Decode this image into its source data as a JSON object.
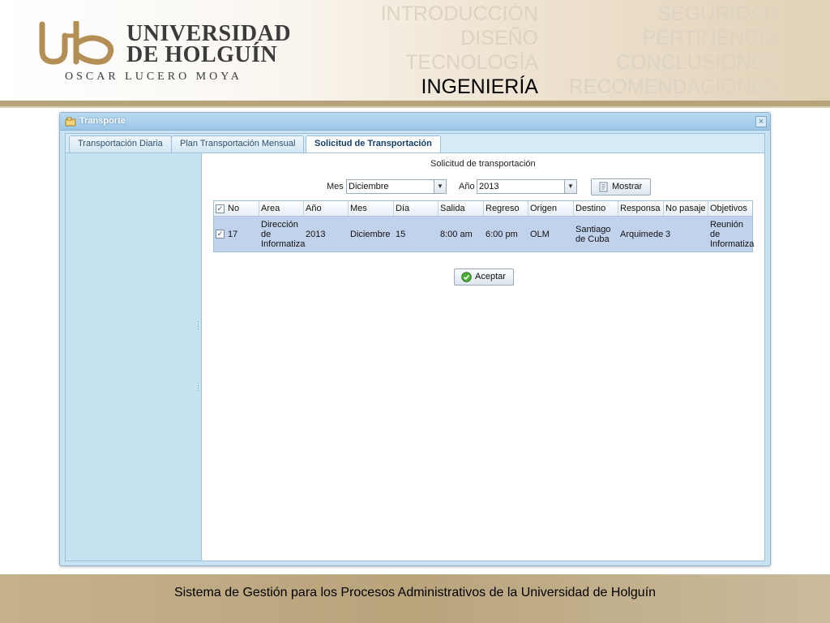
{
  "logo": {
    "line1": "UNIVERSIDAD",
    "line2": "DE HOLGUÍN",
    "subtitle": "OSCAR LUCERO MOYA"
  },
  "nav": {
    "left": [
      "INTRODUCCIÓN",
      "DISEÑO",
      "TECNOLOGÍA",
      "INGENIERÍA"
    ],
    "right": [
      "SEGURIDAD",
      "PERTINENCIA",
      "CONCLUSIONES",
      "RECOMENDACIONES"
    ],
    "active": "INGENIERÍA"
  },
  "window": {
    "title": "Transporte",
    "tabs": [
      "Transportación Diaria",
      "Plan Transportación Mensual",
      "Solicitud de Transportación"
    ],
    "active_tab": "Solicitud de Transportación"
  },
  "form": {
    "title": "Solicitud de transportación",
    "mes_label": "Mes",
    "mes_value": "Diciembre",
    "anio_label": "Año",
    "anio_value": "2013",
    "show_button": "Mostrar",
    "accept_button": "Aceptar"
  },
  "grid": {
    "columns": [
      "No",
      "Area",
      "Año",
      "Mes",
      "Día",
      "Salida",
      "Regreso",
      "Origen",
      "Destino",
      "Responsa",
      "No pasaje",
      "Objetivos"
    ],
    "rows": [
      {
        "checked": true,
        "No": "17",
        "Area": "Dirección de Informatiza",
        "Año": "2013",
        "Mes": "Diciembre",
        "Día": "15",
        "Salida": "8:00 am",
        "Regreso": "6:00 pm",
        "Origen": "OLM",
        "Destino": "Santiago de Cuba",
        "Responsa": "Arquimede",
        "No pasaje": "3",
        "Objetivos": "Reunión de Informatiza"
      }
    ]
  },
  "footer": "Sistema de Gestión para los Procesos Administrativos de la Universidad de Holguín",
  "colors": {
    "accent_gold": "#b7a27b",
    "window_blue": "#c9e3f3",
    "row_selected": "#c1d2ec",
    "nav_inactive": "#dcd3c3"
  }
}
